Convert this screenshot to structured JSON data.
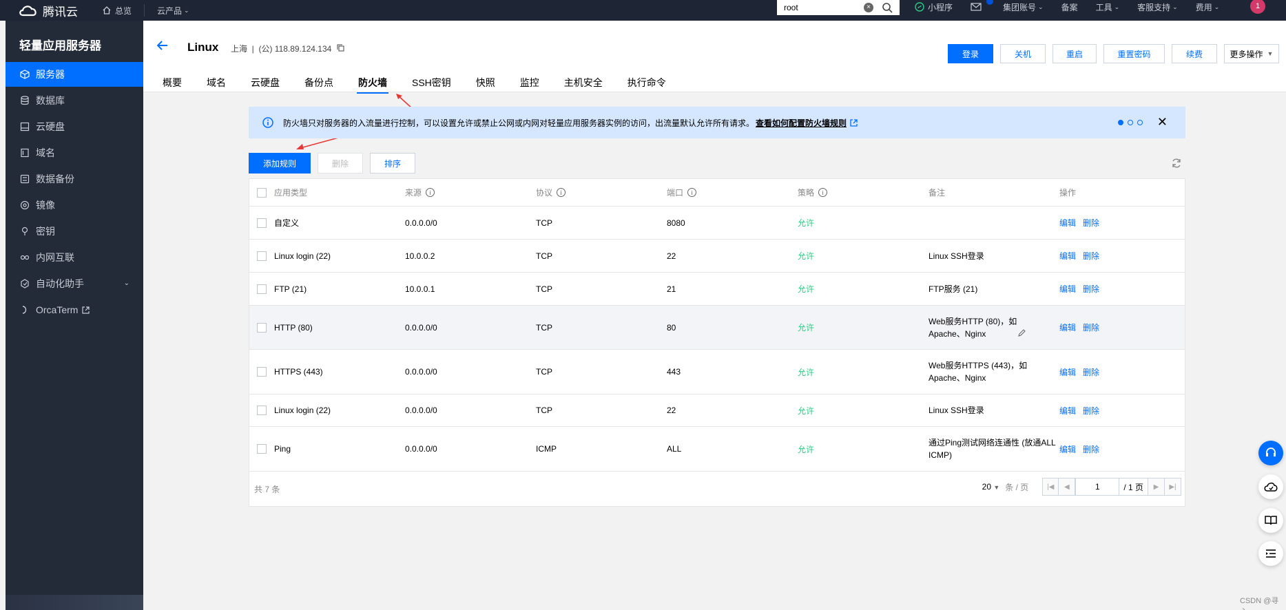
{
  "topbar": {
    "brand": "腾讯云",
    "nav": [
      {
        "label": "总览",
        "icon": "home-icon"
      },
      {
        "label": "云产品",
        "icon": ""
      }
    ],
    "search_value": "root",
    "right_items": [
      {
        "label": "小程序",
        "icon": "miniprogram-icon"
      },
      {
        "label": "集团账号",
        "icon": "mail-icon"
      },
      {
        "label": "备案"
      },
      {
        "label": "工具"
      },
      {
        "label": "客服支持"
      },
      {
        "label": "费用"
      }
    ],
    "avatar_text": "1"
  },
  "sidebar": {
    "title": "轻量应用服务器",
    "items": [
      {
        "label": "服务器",
        "icon": "cube-icon",
        "active": true
      },
      {
        "label": "数据库",
        "icon": "database-icon"
      },
      {
        "label": "云硬盘",
        "icon": "disk-icon"
      },
      {
        "label": "域名",
        "icon": "domain-icon"
      },
      {
        "label": "数据备份",
        "icon": "backup-icon"
      },
      {
        "label": "镜像",
        "icon": "image-icon"
      },
      {
        "label": "密钥",
        "icon": "key-icon"
      },
      {
        "label": "内网互联",
        "icon": "network-icon"
      },
      {
        "label": "自动化助手",
        "icon": "automation-icon"
      },
      {
        "label": "OrcaTerm",
        "icon": "terminal-icon"
      }
    ]
  },
  "instance": {
    "name": "Linux",
    "meta": "上海  |  (公) 118.89.124.134"
  },
  "header_buttons": [
    "登录",
    "关机",
    "重启",
    "重置密码",
    "续费",
    "更多操作"
  ],
  "tabs": [
    "概要",
    "域名",
    "云硬盘",
    "备份点",
    "防火墙",
    "SSH密钥",
    "快照",
    "监控",
    "主机安全",
    "执行命令"
  ],
  "active_tab": "防火墙",
  "notice": {
    "text": "防火墙只对服务器的入流量进行控制，可以设置允许或禁止公网或内网对轻量应用服务器实例的访问，出流量默认允许所有请求。",
    "link": "查看如何配置防火墙规则"
  },
  "actions": {
    "add": "添加规则",
    "delete": "删除",
    "sort": "排序"
  },
  "table": {
    "columns": [
      "应用类型",
      "来源",
      "协议",
      "端口",
      "策略",
      "备注",
      "操作"
    ],
    "rows": [
      {
        "type": "自定义",
        "source": "0.0.0.0/0",
        "protocol": "TCP",
        "port": "8080",
        "policy": "允许",
        "note": ""
      },
      {
        "type": "Linux login (22)",
        "source": "10.0.0.2",
        "protocol": "TCP",
        "port": "22",
        "policy": "允许",
        "note": "Linux SSH登录"
      },
      {
        "type": "FTP (21)",
        "source": "10.0.0.1",
        "protocol": "TCP",
        "port": "21",
        "policy": "允许",
        "note": "FTP服务 (21)"
      },
      {
        "type": "HTTP (80)",
        "source": "0.0.0.0/0",
        "protocol": "TCP",
        "port": "80",
        "policy": "允许",
        "note": "Web服务HTTP (80)，如Apache、Nginx"
      },
      {
        "type": "HTTPS (443)",
        "source": "0.0.0.0/0",
        "protocol": "TCP",
        "port": "443",
        "policy": "允许",
        "note": "Web服务HTTPS (443)，如Apache、Nginx"
      },
      {
        "type": "Linux login (22)",
        "source": "0.0.0.0/0",
        "protocol": "TCP",
        "port": "22",
        "policy": "允许",
        "note": "Linux SSH登录"
      },
      {
        "type": "Ping",
        "source": "0.0.0.0/0",
        "protocol": "ICMP",
        "port": "ALL",
        "policy": "允许",
        "note": "通过Ping测试网络连通性 (放通ALL ICMP)"
      }
    ],
    "op_edit": "编辑",
    "op_delete": "删除",
    "total": "共 7 条",
    "page_size": "20",
    "page_unit": "条 / 页",
    "page_current": "1",
    "page_total": "/ 1 页"
  },
  "watermark": "CSDN @寻心",
  "colors": {
    "accent": "#006eff",
    "allow": "#29cc85",
    "sidebar": "#232a38",
    "topbar": "#1e2636"
  }
}
